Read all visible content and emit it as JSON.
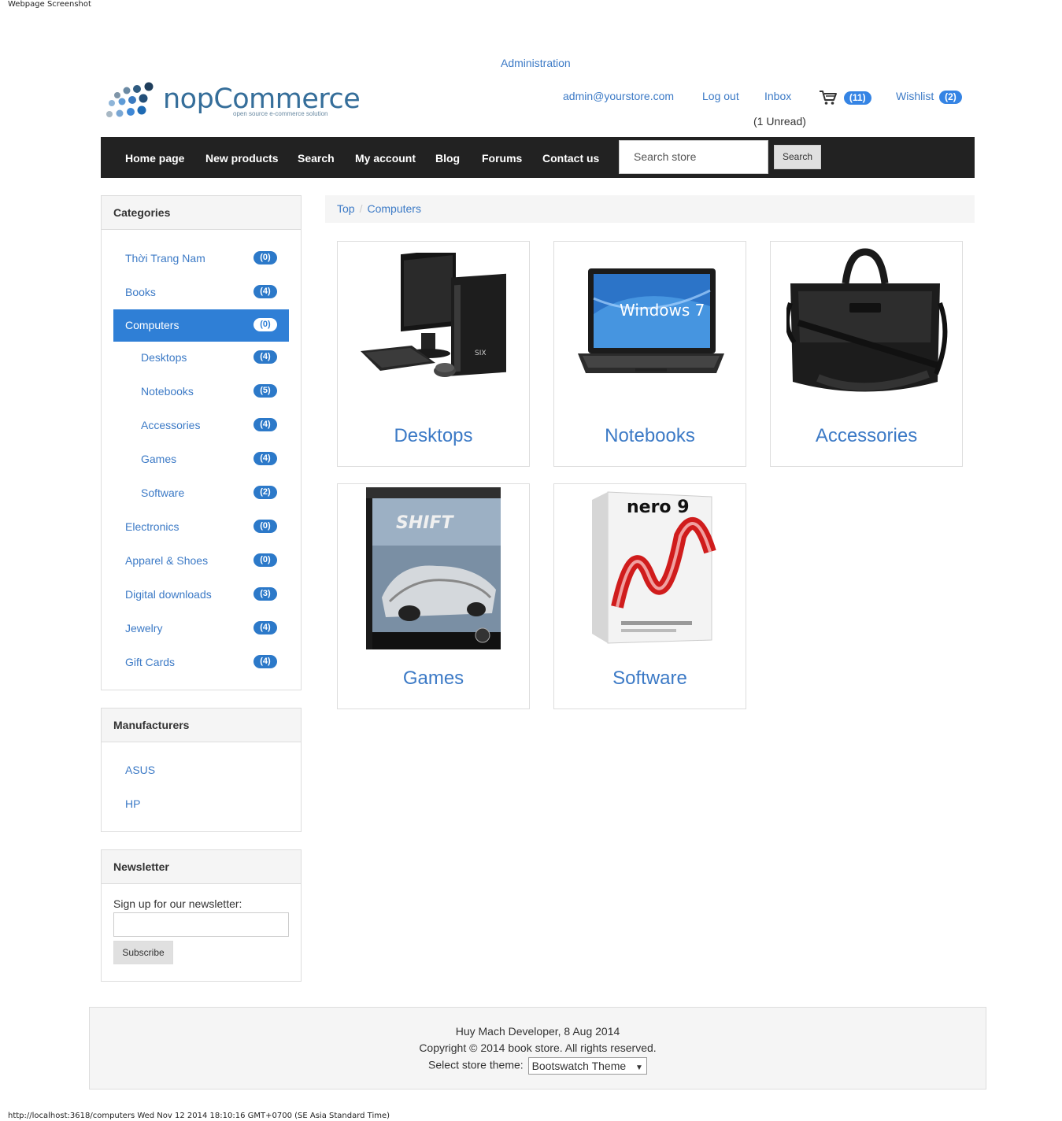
{
  "capture": {
    "label": "Webpage Screenshot",
    "footer_text": "http://localhost:3618/computers Wed Nov 12 2014 18:10:16 GMT+0700 (SE Asia Standard Time)"
  },
  "header": {
    "administration": "Administration",
    "logo_name": "nopCommerce",
    "logo_tagline": "open source e-commerce solution",
    "account_email": "admin@yourstore.com",
    "logout": "Log out",
    "inbox": "Inbox",
    "inbox_unread": "(1 Unread)",
    "cart_count": "(11)",
    "wishlist": "Wishlist",
    "wishlist_count": "(2)"
  },
  "nav": {
    "items": [
      "Home page",
      "New products",
      "Search",
      "My account",
      "Blog",
      "Forums",
      "Contact us"
    ],
    "search_placeholder": "Search store",
    "search_button": "Search"
  },
  "sidebar": {
    "categories_title": "Categories",
    "categories": [
      {
        "label": "Thời Trang Nam",
        "count": "(0)"
      },
      {
        "label": "Books",
        "count": "(4)"
      },
      {
        "label": "Computers",
        "count": "(0)",
        "active": true
      },
      {
        "label": "Desktops",
        "count": "(4)"
      },
      {
        "label": "Notebooks",
        "count": "(5)"
      },
      {
        "label": "Accessories",
        "count": "(4)"
      },
      {
        "label": "Games",
        "count": "(4)"
      },
      {
        "label": "Software",
        "count": "(2)"
      },
      {
        "label": "Electronics",
        "count": "(0)"
      },
      {
        "label": "Apparel & Shoes",
        "count": "(0)"
      },
      {
        "label": "Digital downloads",
        "count": "(3)"
      },
      {
        "label": "Jewelry",
        "count": "(4)"
      },
      {
        "label": "Gift Cards",
        "count": "(4)"
      }
    ],
    "manufacturers_title": "Manufacturers",
    "manufacturers": [
      "ASUS",
      "HP"
    ],
    "newsletter_title": "Newsletter",
    "newsletter_label": "Sign up for our newsletter:",
    "subscribe_button": "Subscribe"
  },
  "breadcrumb": {
    "top": "Top",
    "separator": "/",
    "current": "Computers"
  },
  "subcategories": [
    "Desktops",
    "Notebooks",
    "Accessories",
    "Games",
    "Software"
  ],
  "product_art": {
    "windows_logo_text": "Windows 7",
    "game_title": "SHIFT",
    "software_title": "nero 9"
  },
  "footer": {
    "developer": "Huy Mach Developer, 8 Aug 2014",
    "copyright": "Copyright © 2014 book store. All rights reserved.",
    "theme_label": "Select store theme:",
    "theme_value": "Bootswatch Theme"
  },
  "colors": {
    "link": "#3c7ac6",
    "badge": "#3584e4",
    "navbar": "#222222",
    "active_category": "#2f7fd6"
  }
}
